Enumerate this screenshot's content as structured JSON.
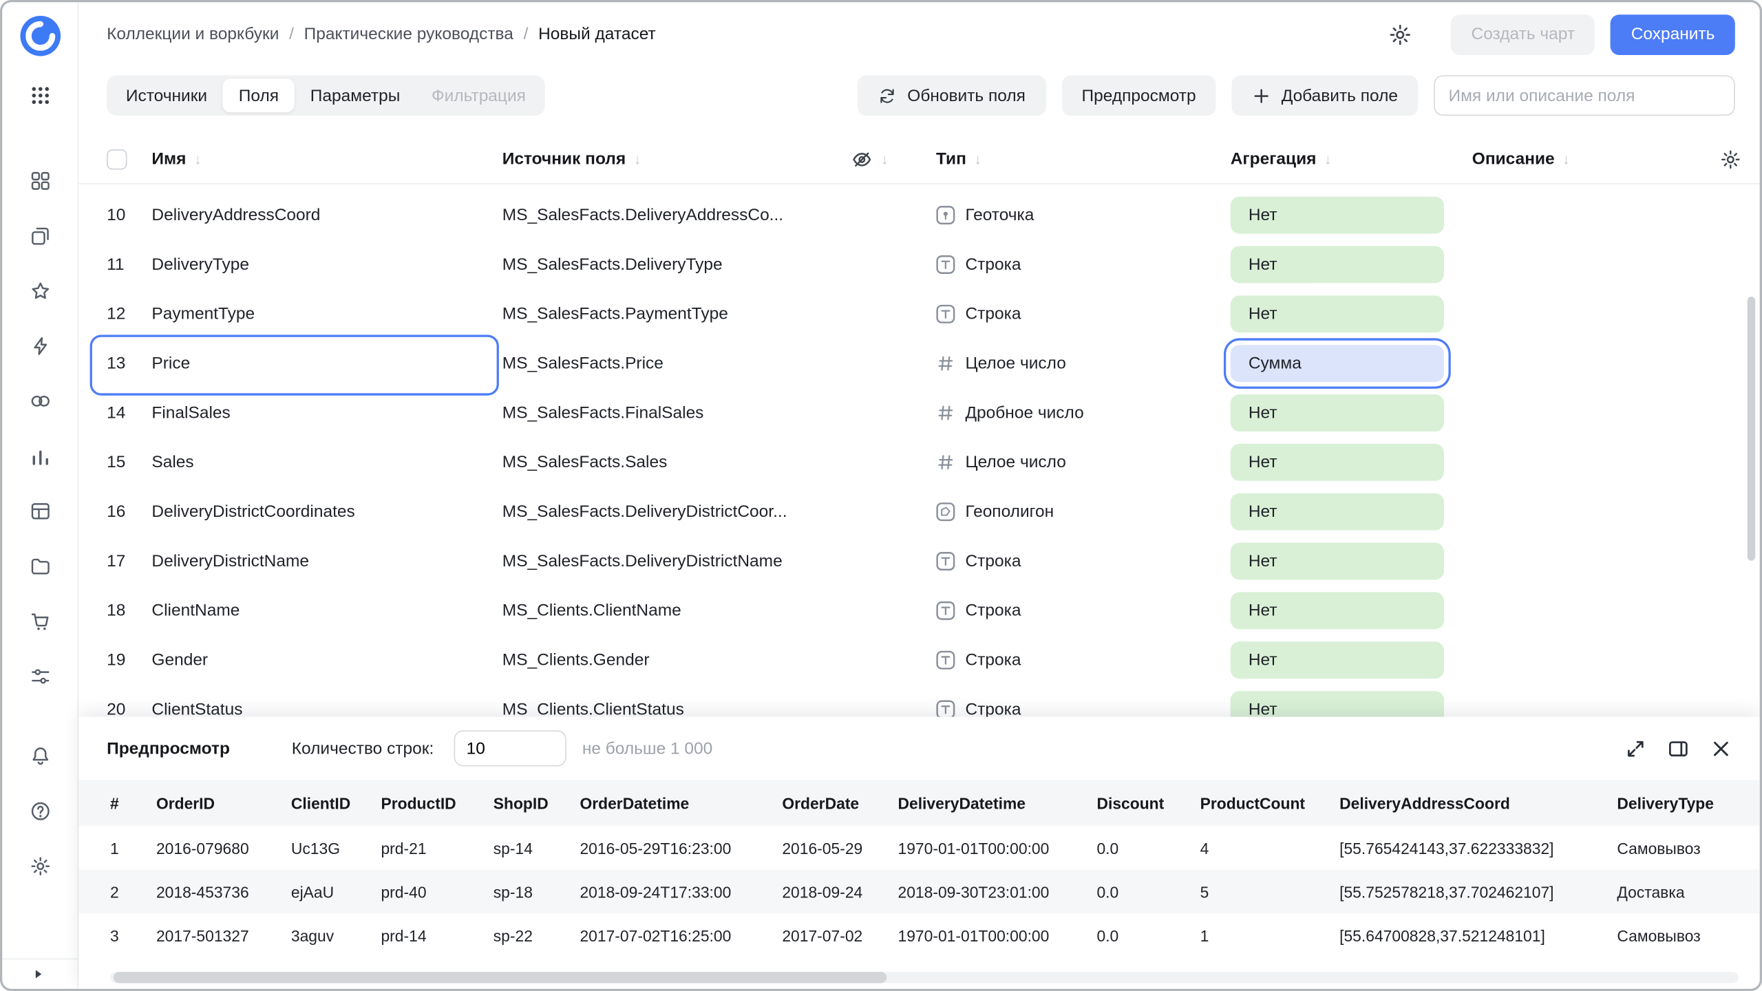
{
  "header": {
    "breadcrumb": [
      "Коллекции и воркбуки",
      "Практические руководства",
      "Новый датасет"
    ],
    "create_chart_label": "Создать чарт",
    "save_label": "Сохранить"
  },
  "sidebar": {
    "icons": [
      "datalens-logo",
      "apps-grid",
      "dashboards",
      "collections",
      "favorites",
      "editor",
      "monitoring",
      "charts",
      "datasets",
      "storage",
      "marketplace",
      "services",
      "notifications",
      "help",
      "settings",
      "expand-sidebar"
    ]
  },
  "tabs": [
    {
      "id": "sources",
      "label": "Источники",
      "state": "normal"
    },
    {
      "id": "fields",
      "label": "Поля",
      "state": "active"
    },
    {
      "id": "parameters",
      "label": "Параметры",
      "state": "normal"
    },
    {
      "id": "filtering",
      "label": "Фильтрация",
      "state": "disabled"
    }
  ],
  "toolbar": {
    "refresh_label": "Обновить поля",
    "preview_label": "Предпросмотр",
    "add_field_label": "Добавить поле",
    "search_placeholder": "Имя или описание поля"
  },
  "fields_table": {
    "columns": {
      "name": "Имя",
      "source": "Источник поля",
      "type": "Тип",
      "aggregation": "Агрегация",
      "description": "Описание"
    },
    "rows": [
      {
        "num": "10",
        "name": "DeliveryAddressCoord",
        "source": "MS_SalesFacts.DeliveryAddressCo...",
        "type": "Геоточка",
        "type_icon": "geopoint",
        "aggregation": "Нет",
        "selected": false
      },
      {
        "num": "11",
        "name": "DeliveryType",
        "source": "MS_SalesFacts.DeliveryType",
        "type": "Строка",
        "type_icon": "string",
        "aggregation": "Нет",
        "selected": false
      },
      {
        "num": "12",
        "name": "PaymentType",
        "source": "MS_SalesFacts.PaymentType",
        "type": "Строка",
        "type_icon": "string",
        "aggregation": "Нет",
        "selected": false
      },
      {
        "num": "13",
        "name": "Price",
        "source": "MS_SalesFacts.Price",
        "type": "Целое число",
        "type_icon": "integer",
        "aggregation": "Сумма",
        "selected": true
      },
      {
        "num": "14",
        "name": "FinalSales",
        "source": "MS_SalesFacts.FinalSales",
        "type": "Дробное число",
        "type_icon": "float",
        "aggregation": "Нет",
        "selected": false
      },
      {
        "num": "15",
        "name": "Sales",
        "source": "MS_SalesFacts.Sales",
        "type": "Целое число",
        "type_icon": "integer",
        "aggregation": "Нет",
        "selected": false
      },
      {
        "num": "16",
        "name": "DeliveryDistrictCoordinates",
        "source": "MS_SalesFacts.DeliveryDistrictCoor...",
        "type": "Геополигон",
        "type_icon": "geopolygon",
        "aggregation": "Нет",
        "selected": false
      },
      {
        "num": "17",
        "name": "DeliveryDistrictName",
        "source": "MS_SalesFacts.DeliveryDistrictName",
        "type": "Строка",
        "type_icon": "string",
        "aggregation": "Нет",
        "selected": false
      },
      {
        "num": "18",
        "name": "ClientName",
        "source": "MS_Clients.ClientName",
        "type": "Строка",
        "type_icon": "string",
        "aggregation": "Нет",
        "selected": false
      },
      {
        "num": "19",
        "name": "Gender",
        "source": "MS_Clients.Gender",
        "type": "Строка",
        "type_icon": "string",
        "aggregation": "Нет",
        "selected": false
      },
      {
        "num": "20",
        "name": "ClientStatus",
        "source": "MS_Clients.ClientStatus",
        "type": "Строка",
        "type_icon": "string",
        "aggregation": "Нет",
        "selected": false
      }
    ]
  },
  "preview": {
    "title": "Предпросмотр",
    "row_count_label": "Количество строк:",
    "row_count_value": "10",
    "row_count_hint": "не больше 1 000",
    "columns": [
      "#",
      "OrderID",
      "ClientID",
      "ProductID",
      "ShopID",
      "OrderDatetime",
      "OrderDate",
      "DeliveryDatetime",
      "Discount",
      "ProductCount",
      "DeliveryAddressCoord",
      "DeliveryType"
    ],
    "rows": [
      [
        "1",
        "2016-079680",
        "Uc13G",
        "prd-21",
        "sp-14",
        "2016-05-29T16:23:00",
        "2016-05-29",
        "1970-01-01T00:00:00",
        "0.0",
        "4",
        "[55.765424143,37.622333832]",
        "Самовывоз"
      ],
      [
        "2",
        "2018-453736",
        "ejAaU",
        "prd-40",
        "sp-18",
        "2018-09-24T17:33:00",
        "2018-09-24",
        "2018-09-30T23:01:00",
        "0.0",
        "5",
        "[55.752578218,37.702462107]",
        "Доставка"
      ],
      [
        "3",
        "2017-501327",
        "3aguv",
        "prd-14",
        "sp-22",
        "2017-07-02T16:25:00",
        "2017-07-02",
        "1970-01-01T00:00:00",
        "0.0",
        "1",
        "[55.64700828,37.521248101]",
        "Самовывоз"
      ]
    ]
  },
  "colors": {
    "accent_blue": "#4d7cf7",
    "green_pill_bg": "#d9f0d6",
    "blue_pill_bg": "#dbe4fb"
  }
}
